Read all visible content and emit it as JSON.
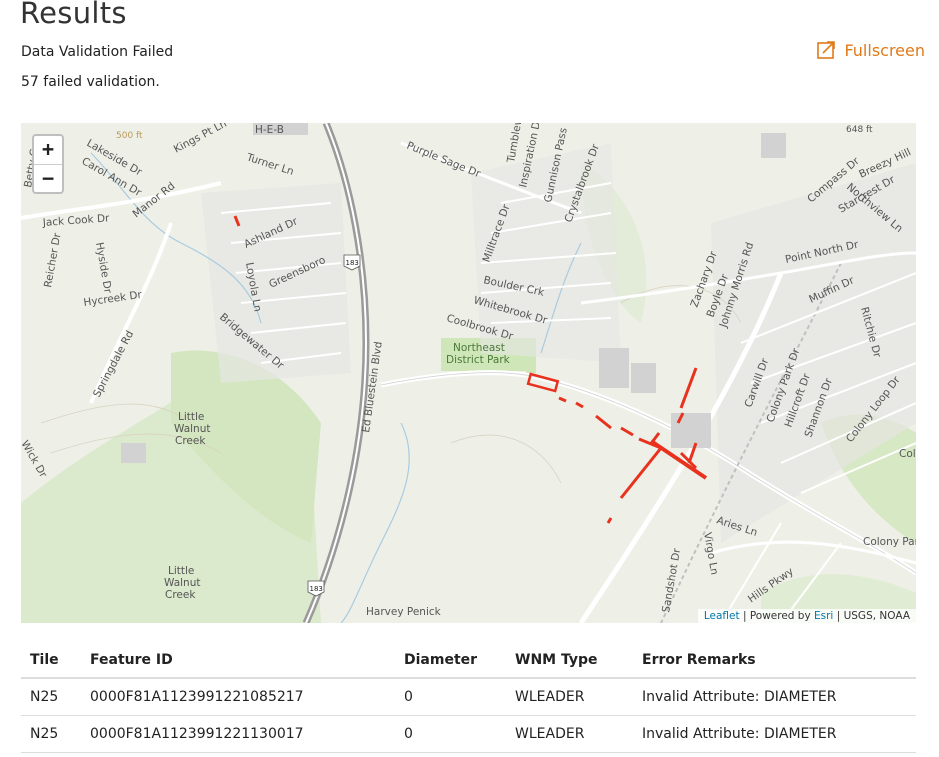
{
  "header": {
    "title": "Results",
    "status": "Data Validation Failed",
    "count_text": "57 failed validation.",
    "fullscreen_label": "Fullscreen"
  },
  "map": {
    "zoom_in": "+",
    "zoom_out": "−",
    "attribution": {
      "leaflet": "Leaflet",
      "powered_by": "| Powered by",
      "esri": "Esri",
      "sources": "| USGS, NOAA"
    },
    "labels": {
      "kings": "Kings Pt Ln",
      "heb": "H-E-B",
      "turner": "Turner Ln",
      "lakeside": "Lakeside Dr",
      "carol": "Carol Ann Dr",
      "manor": "Manor Rd",
      "jackcook": "Jack Cook Dr",
      "ashland": "Ashland Dr",
      "loyola": "Loyola Ln",
      "greensboro": "Greensboro",
      "bridgewater": "Bridgewater Dr",
      "hyside": "Hyside Dr",
      "reicher": "Reicher Dr",
      "hycreek": "Hycreek Dr",
      "springdale": "Springdale Rd",
      "walnut1": [
        "Little",
        "Walnut",
        "Creek"
      ],
      "walnut2": [
        "Little",
        "Walnut",
        "Creek"
      ],
      "bluestein": "Ed Bluestein Blvd",
      "shield1": "183",
      "shield2": "183",
      "purplesage": "Purple Sage Dr",
      "tumbleweed": "Tumblew",
      "inspiration": "Inspiration Dr",
      "gunnison": "Gunnison Pass",
      "crystalbrook": "Crystalbrook Dr",
      "milltrace": "Milltrace Dr",
      "boulder": "Boulder Crk",
      "whitebrook": "Whitebrook Dr",
      "coolbrook": "Coolbrook Dr",
      "nepark": [
        "Northeast",
        "District Park"
      ],
      "zachary": "Zachary Dr",
      "boyle": "Boyle Dr",
      "johnny": "Johnny Morris Rd",
      "pointnorth": "Point North Dr",
      "compass": "Compass Dr",
      "breezy": "Breezy Hill",
      "northview": "Northview Ln",
      "starcrest": "Starcrest Dr",
      "muffin": "Muffin Dr",
      "ritchie": "Ritchie Dr",
      "carwill": "Carwill Dr",
      "colonypark": "Colony Park Dr",
      "hillcroft": "Hillcroft Dr",
      "shannon": "Shannon Dr",
      "colonyloop": "Colony Loop Dr",
      "aries": "Aries Ln",
      "sandshot": "Sandshot Dr",
      "virgo": "Virgo Ln",
      "hills": "Hills Pkwy",
      "colonypark2": "Colony Par",
      "harvey": "Harvey Penick",
      "elev1": "648 ft",
      "elev2": "500 ft",
      "betty": "Betty Coo",
      "cut_col": "Col",
      "cut_wick": "Wick Dr"
    }
  },
  "table": {
    "headers": [
      "Tile",
      "Feature ID",
      "Diameter",
      "WNM Type",
      "Error Remarks"
    ],
    "rows": [
      [
        "N25",
        "0000F81A1123991221085217",
        "0",
        "WLEADER",
        "Invalid Attribute: DIAMETER"
      ],
      [
        "N25",
        "0000F81A1123991221130017",
        "0",
        "WLEADER",
        "Invalid Attribute: DIAMETER"
      ]
    ]
  },
  "colors": {
    "accent": "#e07b1a",
    "error_feature": "#e8321e",
    "park": "#cfe6b8",
    "road": "#ffffff",
    "highway": "#9a9a9a"
  }
}
